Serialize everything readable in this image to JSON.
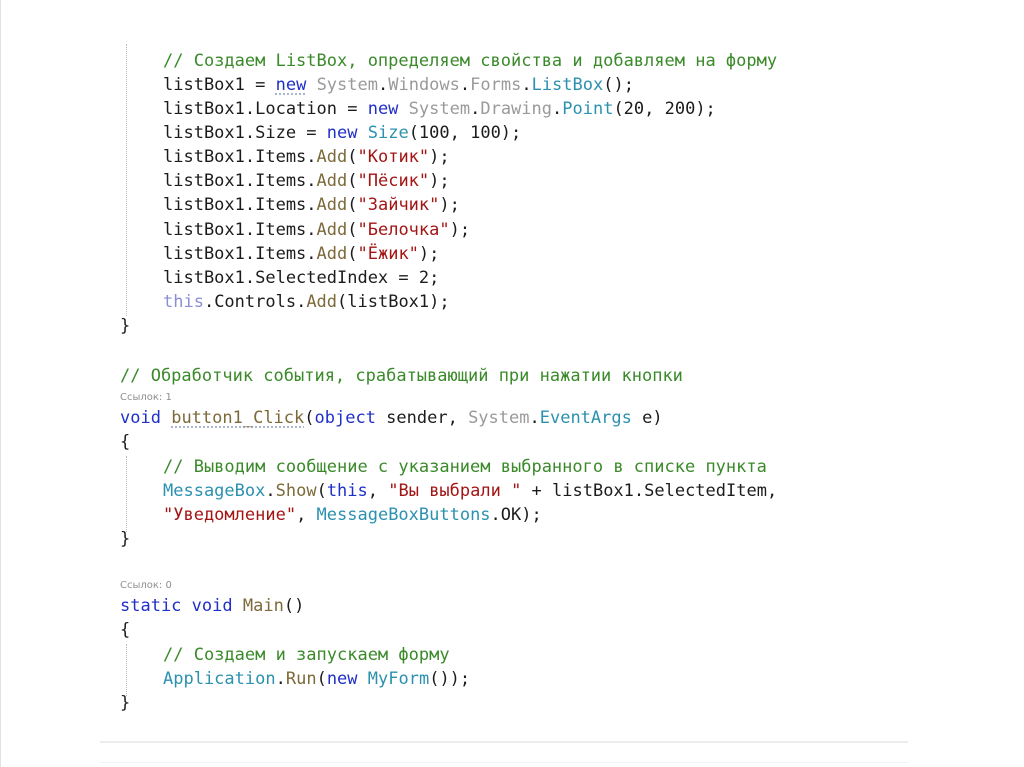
{
  "code_lines": [
    [
      [
        "// Создаем ListBox, определяем свойства и добавляем на форму",
        "com"
      ]
    ],
    [
      [
        "listBox1 = ",
        "plain"
      ],
      [
        "new",
        "kw"
      ],
      [
        " ",
        "plain"
      ],
      [
        "System",
        "ns"
      ],
      [
        ".",
        "plain"
      ],
      [
        "Windows",
        "ns"
      ],
      [
        ".",
        "plain"
      ],
      [
        "Forms",
        "ns"
      ],
      [
        ".",
        "plain"
      ],
      [
        "ListBox",
        "type"
      ],
      [
        "();",
        "plain"
      ]
    ],
    [
      [
        "listBox1.Location = ",
        "plain"
      ],
      [
        "new",
        "kw"
      ],
      [
        " ",
        "plain"
      ],
      [
        "System",
        "ns"
      ],
      [
        ".",
        "plain"
      ],
      [
        "Drawing",
        "ns"
      ],
      [
        ".",
        "plain"
      ],
      [
        "Point",
        "type"
      ],
      [
        "(20, 200);",
        "plain"
      ]
    ],
    [
      [
        "listBox1.Size = ",
        "plain"
      ],
      [
        "new",
        "kw"
      ],
      [
        " ",
        "plain"
      ],
      [
        "Size",
        "type"
      ],
      [
        "(100, 100);",
        "plain"
      ]
    ],
    [
      [
        "listBox1.Items.",
        "plain"
      ],
      [
        "Add",
        "meth"
      ],
      [
        "(",
        "plain"
      ],
      [
        "\"Котик\"",
        "str"
      ],
      [
        ");",
        "plain"
      ]
    ],
    [
      [
        "listBox1.Items.",
        "plain"
      ],
      [
        "Add",
        "meth"
      ],
      [
        "(",
        "plain"
      ],
      [
        "\"Пёсик\"",
        "str"
      ],
      [
        ");",
        "plain"
      ]
    ],
    [
      [
        "listBox1.Items.",
        "plain"
      ],
      [
        "Add",
        "meth"
      ],
      [
        "(",
        "plain"
      ],
      [
        "\"Зайчик\"",
        "str"
      ],
      [
        ");",
        "plain"
      ]
    ],
    [
      [
        "listBox1.Items.",
        "plain"
      ],
      [
        "Add",
        "meth"
      ],
      [
        "(",
        "plain"
      ],
      [
        "\"Белочка\"",
        "str"
      ],
      [
        ");",
        "plain"
      ]
    ],
    [
      [
        "listBox1.Items.",
        "plain"
      ],
      [
        "Add",
        "meth"
      ],
      [
        "(",
        "plain"
      ],
      [
        "\"Ёжик\"",
        "str"
      ],
      [
        ");",
        "plain"
      ]
    ],
    [
      [
        "listBox1.SelectedIndex = 2;",
        "plain"
      ]
    ],
    [
      [
        "this",
        "this"
      ],
      [
        ".Controls.",
        "plain"
      ],
      [
        "Add",
        "meth"
      ],
      [
        "(listBox1);",
        "plain"
      ]
    ],
    [
      [
        "}",
        "plain"
      ]
    ],
    [
      [
        "// Обработчик события, срабатывающий при нажатии кнопки",
        "com"
      ]
    ],
    [
      [
        "void",
        "kw"
      ],
      [
        " ",
        "plain"
      ],
      [
        "button1_Click",
        "meth"
      ],
      [
        "(",
        "plain"
      ],
      [
        "object",
        "kw"
      ],
      [
        " sender, ",
        "plain"
      ],
      [
        "System",
        "ns"
      ],
      [
        ".",
        "plain"
      ],
      [
        "EventArgs",
        "type"
      ],
      [
        " e)",
        "plain"
      ]
    ],
    [
      [
        "{",
        "plain"
      ]
    ],
    [
      [
        "// Выводим сообщение с указанием выбранного в списке пункта",
        "com"
      ]
    ],
    [
      [
        "MessageBox",
        "type"
      ],
      [
        ".",
        "plain"
      ],
      [
        "Show",
        "meth"
      ],
      [
        "(",
        "plain"
      ],
      [
        "this",
        "kw"
      ],
      [
        ", ",
        "plain"
      ],
      [
        "\"Вы выбрали \"",
        "str"
      ],
      [
        " + listBox1.SelectedItem,",
        "plain"
      ]
    ],
    [
      [
        "\"Уведомление\"",
        "str"
      ],
      [
        ", ",
        "plain"
      ],
      [
        "MessageBoxButtons",
        "type"
      ],
      [
        ".OK);",
        "plain"
      ]
    ],
    [
      [
        "}",
        "plain"
      ]
    ],
    [
      [
        "static",
        "kw"
      ],
      [
        " ",
        "plain"
      ],
      [
        "void",
        "kw"
      ],
      [
        " ",
        "plain"
      ],
      [
        "Main",
        "meth"
      ],
      [
        "()",
        "plain"
      ]
    ],
    [
      [
        "{",
        "plain"
      ]
    ],
    [
      [
        "// Создаем и запускаем форму",
        "com"
      ]
    ],
    [
      [
        "Application",
        "type"
      ],
      [
        ".",
        "plain"
      ],
      [
        "Run",
        "meth"
      ],
      [
        "(",
        "plain"
      ],
      [
        "new",
        "kw"
      ],
      [
        " ",
        "plain"
      ],
      [
        "MyForm",
        "type"
      ],
      [
        "());",
        "plain"
      ]
    ],
    [
      [
        "}",
        "plain"
      ]
    ]
  ],
  "reference_hints": [
    "Ссылок: 1",
    "Ссылок: 0"
  ]
}
